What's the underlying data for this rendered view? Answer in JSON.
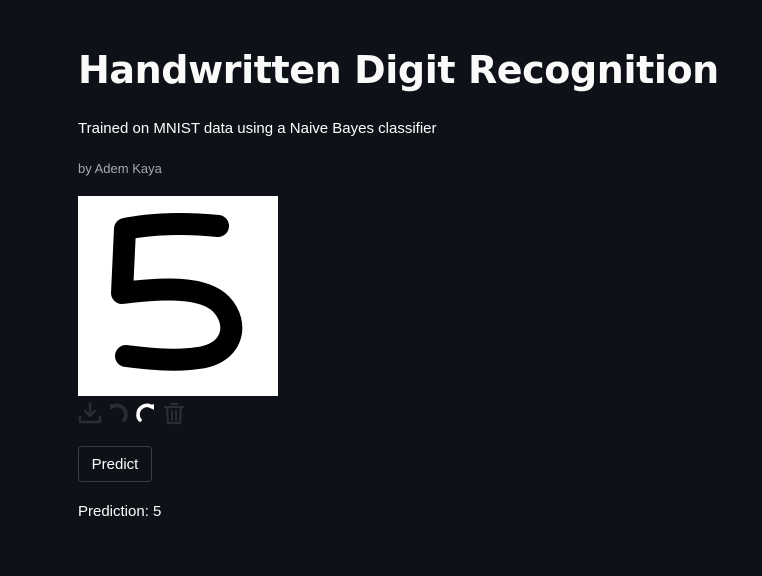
{
  "header": {
    "title": "Handwritten Digit Recognition",
    "subtitle": "Trained on MNIST data using a Naive Bayes classifier",
    "byline": "by Adem Kaya"
  },
  "canvas": {
    "background": "#ffffff",
    "stroke_color": "#000000",
    "drawn_digit": "5"
  },
  "toolbar": {
    "tools": [
      "download-icon",
      "undo-icon",
      "redo-icon",
      "trash-icon"
    ]
  },
  "actions": {
    "predict_label": "Predict"
  },
  "result": {
    "prediction_text": "Prediction: 5"
  },
  "colors": {
    "background": "#0e1117",
    "text": "#fafafa",
    "muted_text": "#a3a8b4",
    "button_border": "#3a3d47"
  }
}
